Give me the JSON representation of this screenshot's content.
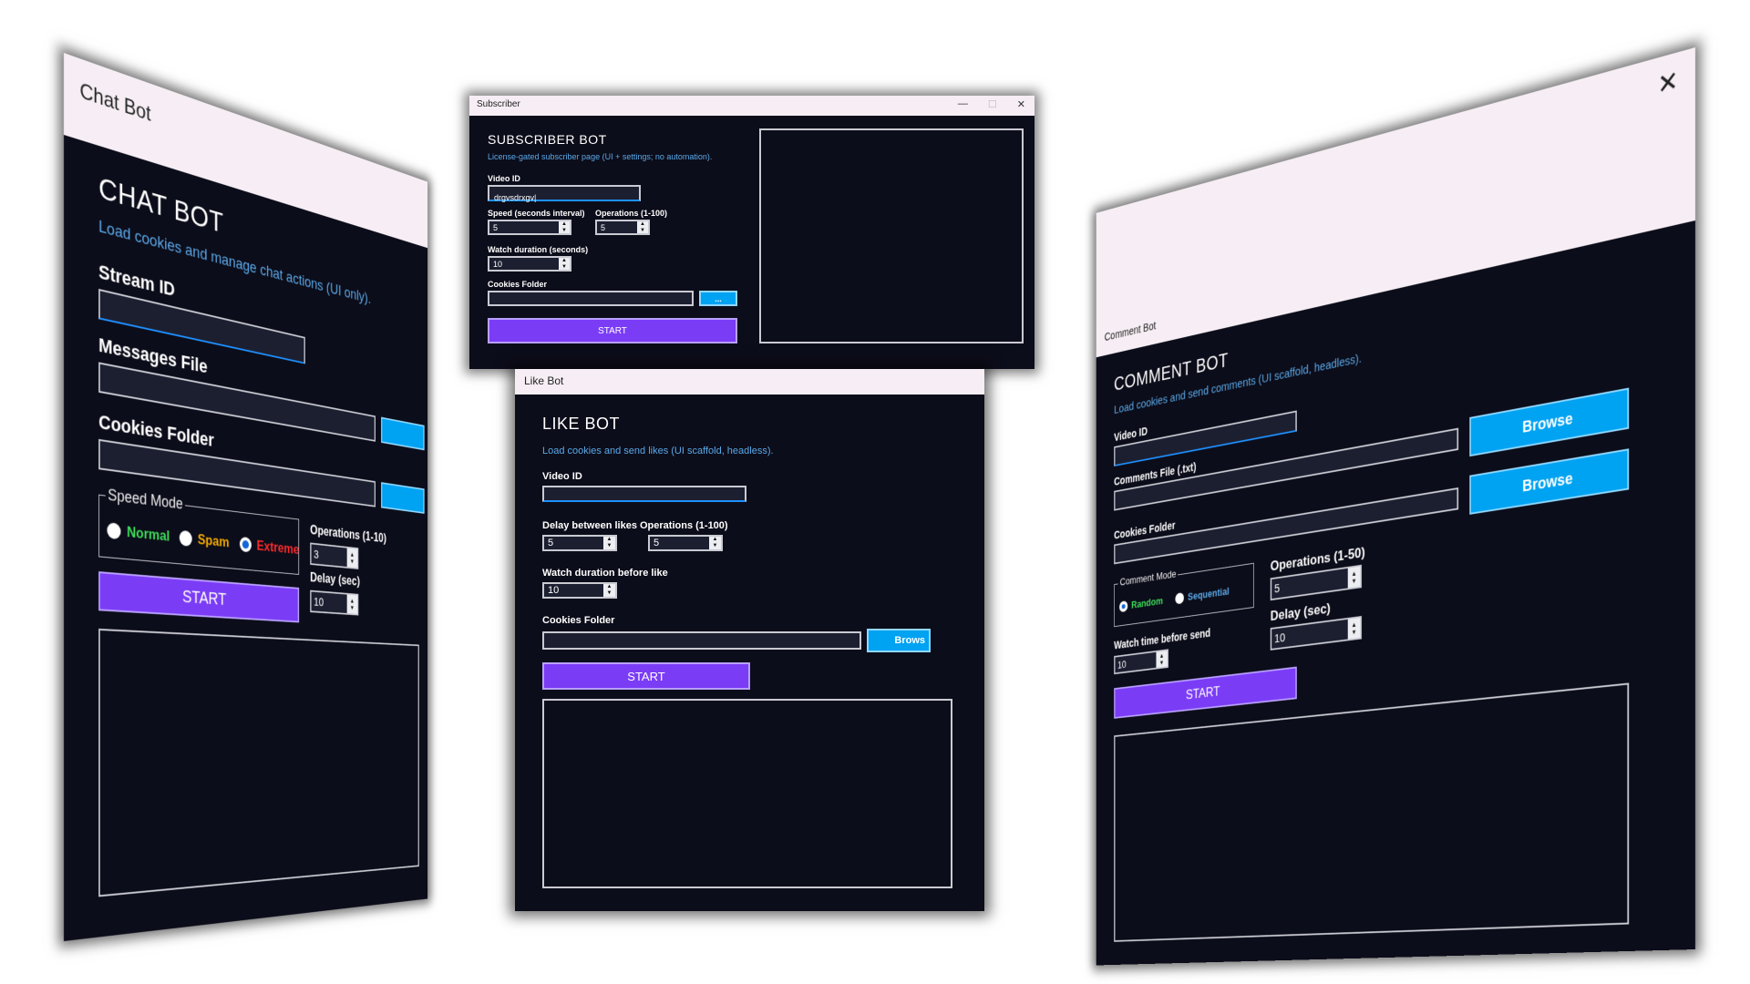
{
  "chat": {
    "window_title": "Chat Bot",
    "heading": "CHAT BOT",
    "subtitle": "Load cookies and manage chat actions (UI only).",
    "stream_id_label": "Stream ID",
    "stream_id_value": "",
    "messages_file_label": "Messages File",
    "cookies_folder_label": "Cookies Folder",
    "speed_mode_legend": "Speed Mode",
    "speed_modes": [
      {
        "label": "Normal",
        "color": "#3ddc5a",
        "selected": false
      },
      {
        "label": "Spam",
        "color": "#f2a900",
        "selected": false
      },
      {
        "label": "Extreme",
        "color": "#ff2b2b",
        "selected": true
      }
    ],
    "operations_label": "Operations (1-10)",
    "operations_value": "3",
    "delay_label": "Delay (sec)",
    "delay_value": "10",
    "start_label": "START"
  },
  "subscriber": {
    "window_title": "Subscriber",
    "heading": "SUBSCRIBER BOT",
    "subtitle": "License-gated subscriber page (UI + settings; no automation).",
    "video_id_label": "Video ID",
    "video_id_value": "drgvsdrxgv|",
    "speed_label": "Speed (seconds interval)",
    "speed_value": "5",
    "operations_label": "Operations (1-100)",
    "operations_value": "5",
    "watch_label": "Watch duration (seconds)",
    "watch_value": "10",
    "cookies_label": "Cookies Folder",
    "browse_label": "...",
    "start_label": "START",
    "minimize": "—",
    "maximize": "☐",
    "close": "✕"
  },
  "like": {
    "window_title": "Like Bot",
    "heading": "LIKE BOT",
    "subtitle": "Load cookies and send likes (UI scaffold, headless).",
    "video_id_label": "Video ID",
    "delay_ops_label": "Delay between likes Operations (1-100)",
    "delay_value": "5",
    "operations_value": "5",
    "watch_label": "Watch duration before like",
    "watch_value": "10",
    "cookies_label": "Cookies Folder",
    "browse_label": "Brows",
    "start_label": "START"
  },
  "comment": {
    "window_title": "Comment Bot",
    "heading": "COMMENT BOT",
    "subtitle": "Load cookies and send comments (UI scaffold, headless).",
    "video_id_label": "Video ID",
    "comments_file_label": "Comments File (.txt)",
    "cookies_label": "Cookies Folder",
    "browse1_label": "Browse",
    "browse2_label": "Browse",
    "comment_mode_legend": "Comment Mode",
    "modes": [
      {
        "label": "Random",
        "color": "#3ddc5a",
        "selected": true
      },
      {
        "label": "Sequential",
        "color": "#5aa8e8",
        "selected": false
      }
    ],
    "operations_label": "Operations (1-50)",
    "operations_value": "5",
    "delay_label": "Delay (sec)",
    "delay_value": "10",
    "watch_label": "Watch time before send",
    "watch_value": "10",
    "start_label": "START",
    "close": "✕"
  }
}
